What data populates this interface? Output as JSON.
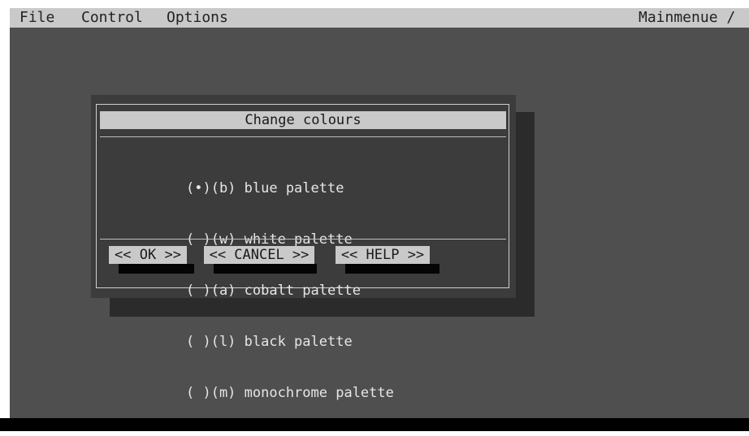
{
  "menubar": {
    "items": [
      "File",
      "Control",
      "Options"
    ],
    "right": "Mainmenue  /"
  },
  "dialog": {
    "title": "Change colours",
    "options": [
      "(•)(b) blue palette",
      "( )(w) white palette",
      "( )(a) cobalt palette",
      "( )(l) black palette",
      "( )(m) monochrome palette"
    ],
    "buttons": {
      "ok": "<< OK >>",
      "cancel": "<< CANCEL >>",
      "help": "<< HELP >>"
    }
  },
  "colors": {
    "menubar_bg": "#c9c9c9",
    "desktop_bg": "#4f4f4f",
    "dialog_bg": "#3c3c3c",
    "dialog_text": "#e6e6e6",
    "button_bg": "#c9c9c9"
  }
}
